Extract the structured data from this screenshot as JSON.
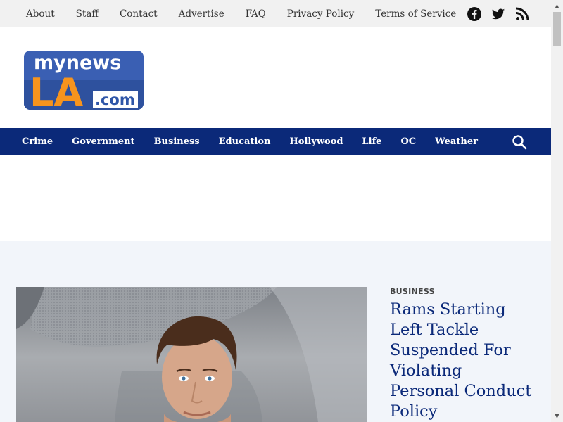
{
  "top_nav": {
    "links": [
      "About",
      "Staff",
      "Contact",
      "Advertise",
      "FAQ",
      "Privacy Policy",
      "Terms of Service"
    ],
    "social_icons": [
      "facebook-icon",
      "twitter-icon",
      "rss-icon"
    ]
  },
  "logo": {
    "line1": "mynews",
    "line2": "LA",
    "line3": ".com"
  },
  "main_nav": {
    "links": [
      "Crime",
      "Government",
      "Business",
      "Education",
      "Hollywood",
      "Life",
      "OC",
      "Weather"
    ],
    "search_icon": "search-icon"
  },
  "featured": {
    "category": "BUSINESS",
    "headline": "Rams Starting Left Tackle Suspended For Violating Personal Conduct Policy"
  },
  "colors": {
    "nav_background": "#0b2979",
    "topbar_background": "#f1f1f1",
    "featured_background": "#f2f5fa",
    "headline_color": "#0b2979",
    "logo_orange": "#f7941d",
    "logo_blue": "#2f56a8"
  }
}
